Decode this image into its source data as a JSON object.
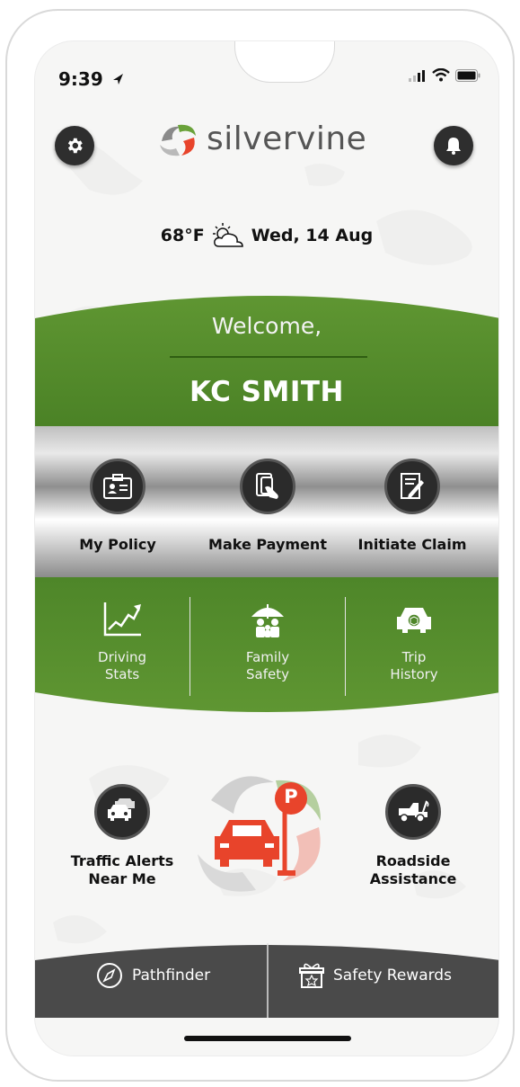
{
  "status": {
    "time": "9:39"
  },
  "header": {
    "logo_text": "silvervine",
    "settings_icon": "gear-icon",
    "notifications_icon": "bell-icon"
  },
  "weather": {
    "temperature": "68°F",
    "icon": "partly-cloudy-icon",
    "date": "Wed, 14 Aug"
  },
  "welcome": {
    "greeting": "Welcome,",
    "user_name": "KC SMITH"
  },
  "actions": [
    {
      "label": "My Policy",
      "icon": "id-card-icon"
    },
    {
      "label": "Make Payment",
      "icon": "card-payment-icon"
    },
    {
      "label": "Initiate Claim",
      "icon": "claim-form-icon"
    }
  ],
  "features": [
    {
      "label_line1": "Driving",
      "label_line2": "Stats",
      "icon": "line-chart-icon"
    },
    {
      "label_line1": "Family",
      "label_line2": "Safety",
      "icon": "family-umbrella-icon"
    },
    {
      "label_line1": "Trip",
      "label_line2": "History",
      "icon": "car-map-icon"
    }
  ],
  "services": {
    "traffic": {
      "line1": "Traffic Alerts",
      "line2": "Near Me",
      "icon": "traffic-cars-icon"
    },
    "center_icon": "car-parking-icon",
    "center_badge": "P",
    "roadside": {
      "line1": "Roadside",
      "line2": "Assistance",
      "icon": "tow-truck-icon"
    }
  },
  "bottom_nav": [
    {
      "label": "Pathfinder",
      "icon": "compass-icon"
    },
    {
      "label": "Safety Rewards",
      "icon": "gift-icon"
    }
  ],
  "colors": {
    "green": "#5a8f2e",
    "dark_green": "#3e6d1a",
    "dark_bar": "#4a4a4a",
    "accent_red": "#e8442b"
  }
}
